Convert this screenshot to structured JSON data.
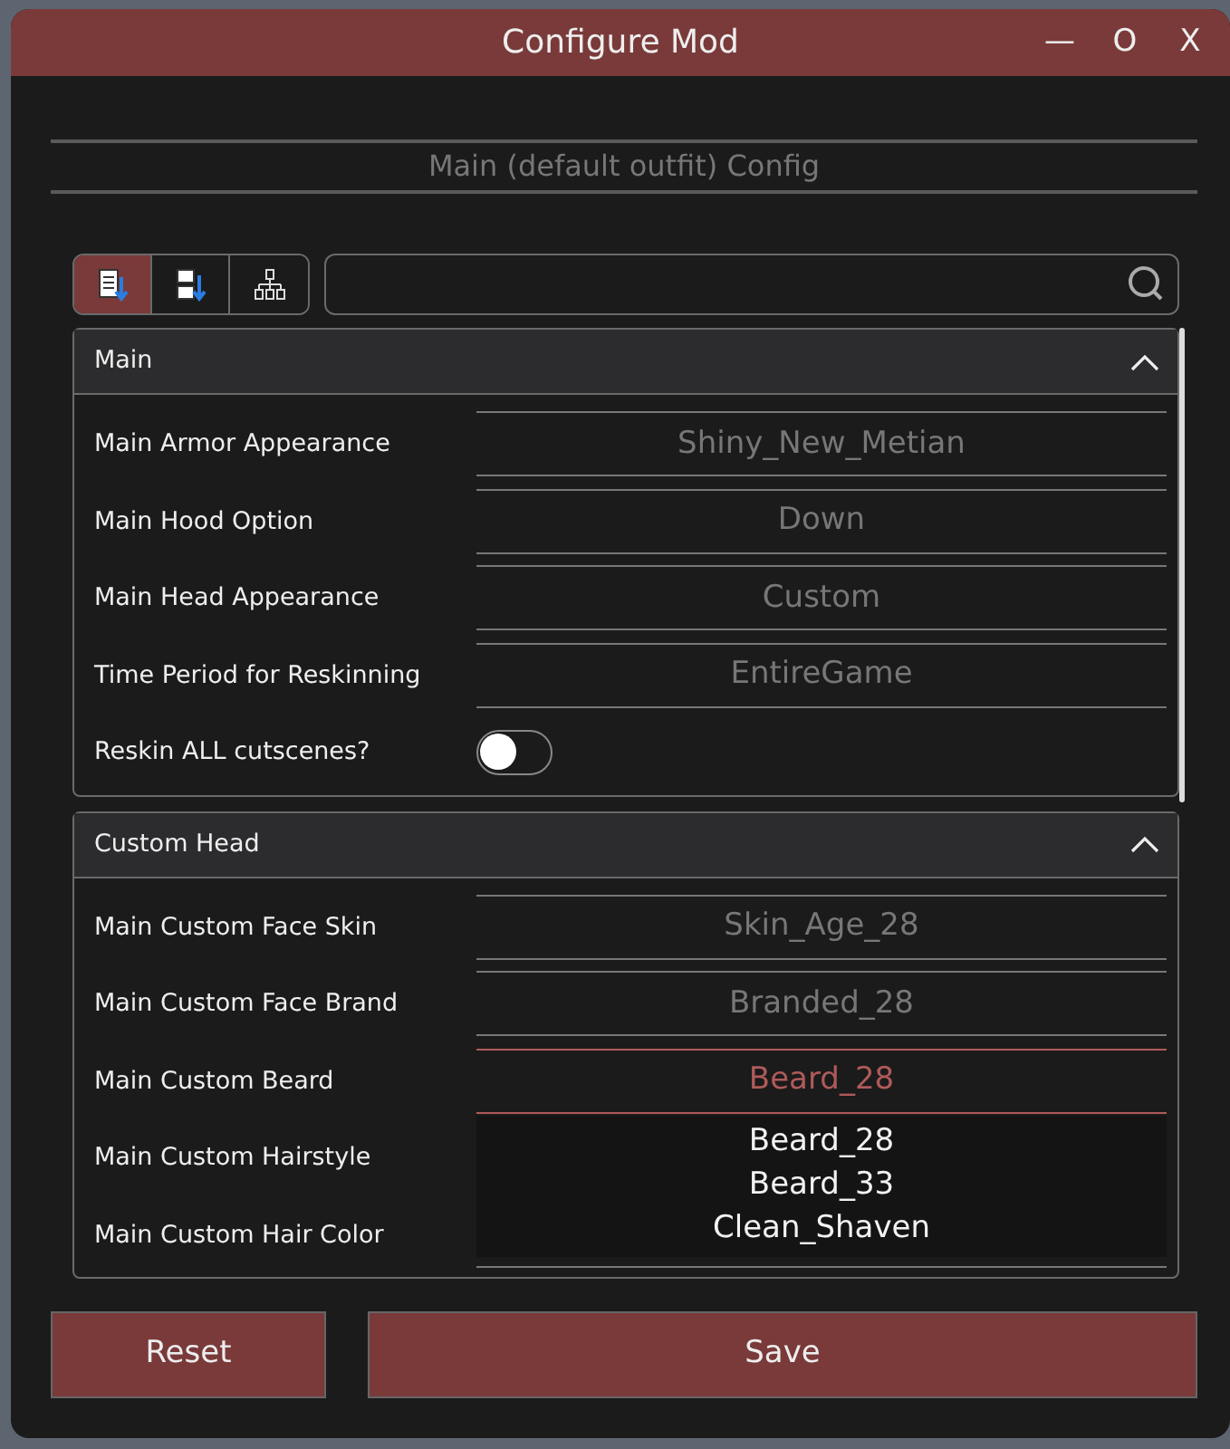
{
  "window": {
    "title": "Configure Mod",
    "controls": [
      "—",
      "O",
      "X"
    ]
  },
  "heading": "Main (default outfit) Config",
  "view_buttons": [
    {
      "kind": "list-sort",
      "selected": true
    },
    {
      "kind": "alpha-sort",
      "selected": false
    },
    {
      "kind": "tree",
      "selected": false
    }
  ],
  "sections": [
    {
      "title": "Main",
      "expanded": true,
      "settings": [
        {
          "label": "Main Armor Appearance",
          "kind": "select",
          "value": "Shiny_New_Metian"
        },
        {
          "label": "Main Hood Option",
          "kind": "select",
          "value": "Down"
        },
        {
          "label": "Main Head Appearance",
          "kind": "select",
          "value": "Custom"
        },
        {
          "label": "Time Period for Reskinning",
          "kind": "select",
          "value": "EntireGame"
        },
        {
          "label": "Reskin ALL cutscenes?",
          "kind": "toggle",
          "on": false
        }
      ]
    },
    {
      "title": "Custom Head",
      "expanded": true,
      "settings": [
        {
          "label": "Main Custom Face Skin",
          "kind": "select",
          "value": "Skin_Age_28"
        },
        {
          "label": "Main Custom Face Brand",
          "kind": "select",
          "value": "Branded_28"
        },
        {
          "label": "Main Custom Beard",
          "kind": "select",
          "value": "Beard_28",
          "open": true,
          "options": [
            "Beard_28",
            "Beard_33",
            "Clean_Shaven"
          ]
        },
        {
          "label": "Main Custom Hairstyle",
          "kind": "hidden"
        },
        {
          "label": "Main Custom Hair Color",
          "kind": "select"
        }
      ]
    }
  ],
  "buttons": [
    "Reset",
    "Save"
  ]
}
